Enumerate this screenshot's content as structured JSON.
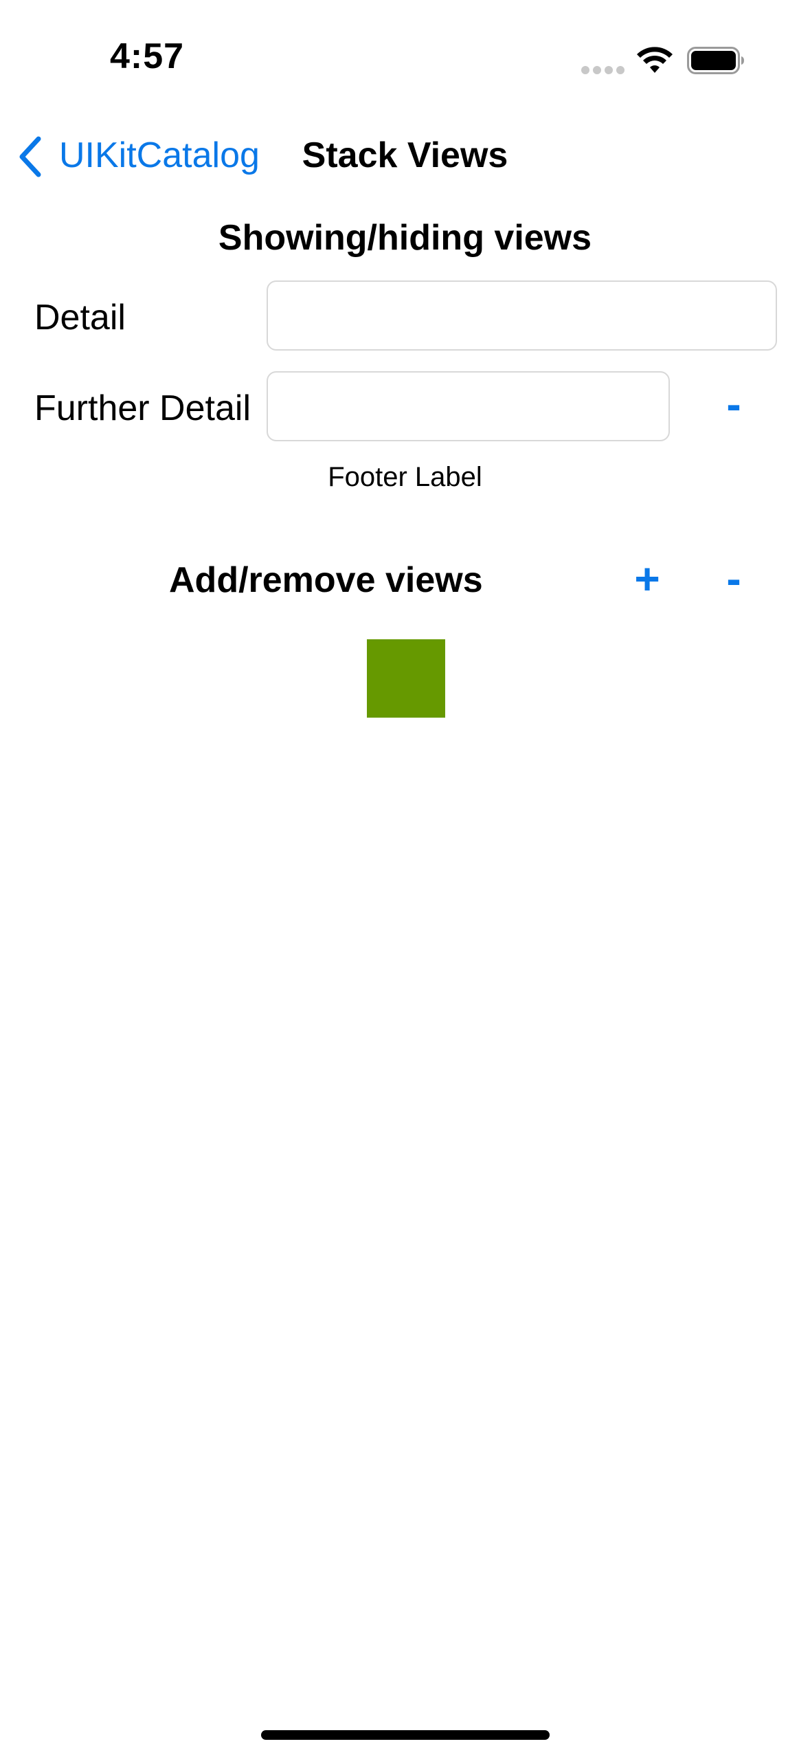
{
  "status_bar": {
    "time": "4:57"
  },
  "nav": {
    "back_label": "UIKitCatalog",
    "title": "Stack Views"
  },
  "section_show_hide": {
    "title": "Showing/hiding views",
    "detail_label": "Detail",
    "detail_value": "",
    "further_detail_label": "Further Detail",
    "further_detail_value": "",
    "remove_label": "-",
    "footer_label": "Footer Label"
  },
  "section_add_remove": {
    "title": "Add/remove views",
    "add_label": "+",
    "remove_label": "-",
    "view_color": "#669900"
  },
  "colors": {
    "accent": "#0a78e8"
  },
  "icons": {
    "signal": "cellular-signal-icon",
    "wifi": "wifi-icon",
    "battery": "battery-icon",
    "back": "chevron-left-icon"
  }
}
